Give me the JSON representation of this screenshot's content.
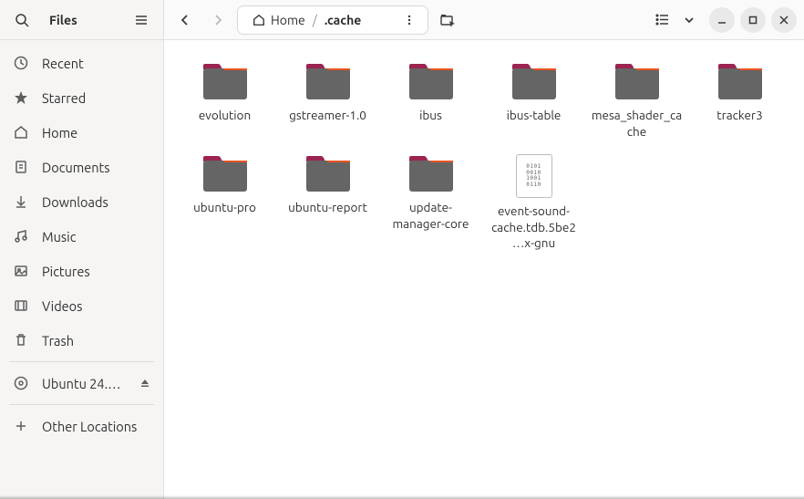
{
  "app_title": "Files",
  "sidebar": {
    "items": [
      {
        "label": "Recent",
        "icon": "clock"
      },
      {
        "label": "Starred",
        "icon": "star"
      },
      {
        "label": "Home",
        "icon": "home"
      },
      {
        "label": "Documents",
        "icon": "documents"
      },
      {
        "label": "Downloads",
        "icon": "downloads"
      },
      {
        "label": "Music",
        "icon": "music"
      },
      {
        "label": "Pictures",
        "icon": "pictures"
      },
      {
        "label": "Videos",
        "icon": "videos"
      },
      {
        "label": "Trash",
        "icon": "trash"
      }
    ],
    "mount": {
      "label": "Ubuntu 24.…",
      "icon": "disc"
    },
    "other": {
      "label": "Other Locations",
      "icon": "plus"
    }
  },
  "path": {
    "home_label": "Home",
    "current": ".cache"
  },
  "items": [
    {
      "name": "evolution",
      "type": "folder"
    },
    {
      "name": "gstreamer-1.0",
      "type": "folder"
    },
    {
      "name": "ibus",
      "type": "folder"
    },
    {
      "name": "ibus-table",
      "type": "folder"
    },
    {
      "name": "mesa_shader_cache",
      "type": "folder"
    },
    {
      "name": "tracker3",
      "type": "folder"
    },
    {
      "name": "ubuntu-pro",
      "type": "folder"
    },
    {
      "name": "ubuntu-report",
      "type": "folder"
    },
    {
      "name": "update-manager-core",
      "type": "folder"
    },
    {
      "name": "event-sound-cache.tdb.5be2…x-gnu",
      "type": "file"
    }
  ]
}
